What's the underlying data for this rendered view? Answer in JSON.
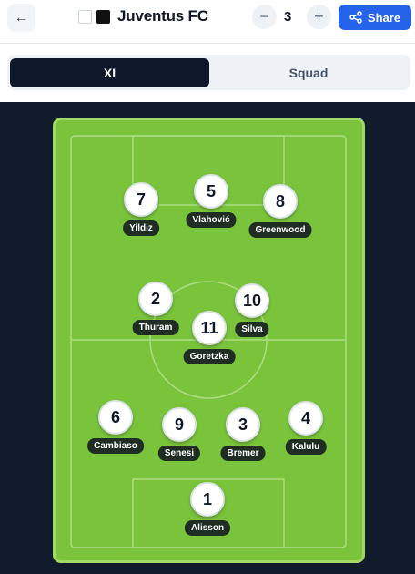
{
  "header": {
    "back_icon": "←",
    "team_name": "Juventus FC",
    "kit_colors": [
      "#ffffff",
      "#111111"
    ],
    "stepper": {
      "minus": "−",
      "value": "3",
      "plus": "+"
    },
    "share_label": "Share"
  },
  "tabs": [
    {
      "label": "XI",
      "active": true
    },
    {
      "label": "Squad",
      "active": false
    }
  ],
  "colors": {
    "pitch": "#7ac43c",
    "pitch_border": "#a4d866",
    "background": "#111b2c",
    "accent": "#2563eb"
  },
  "players": [
    {
      "number": "7",
      "name": "Yildiz"
    },
    {
      "number": "5",
      "name": "Vlahović"
    },
    {
      "number": "8",
      "name": "Greenwood"
    },
    {
      "number": "2",
      "name": "Thuram"
    },
    {
      "number": "10",
      "name": "Silva"
    },
    {
      "number": "11",
      "name": "Goretzka"
    },
    {
      "number": "6",
      "name": "Cambiaso"
    },
    {
      "number": "9",
      "name": "Senesi"
    },
    {
      "number": "3",
      "name": "Bremer"
    },
    {
      "number": "4",
      "name": "Kalulu"
    },
    {
      "number": "1",
      "name": "Alisson"
    }
  ]
}
